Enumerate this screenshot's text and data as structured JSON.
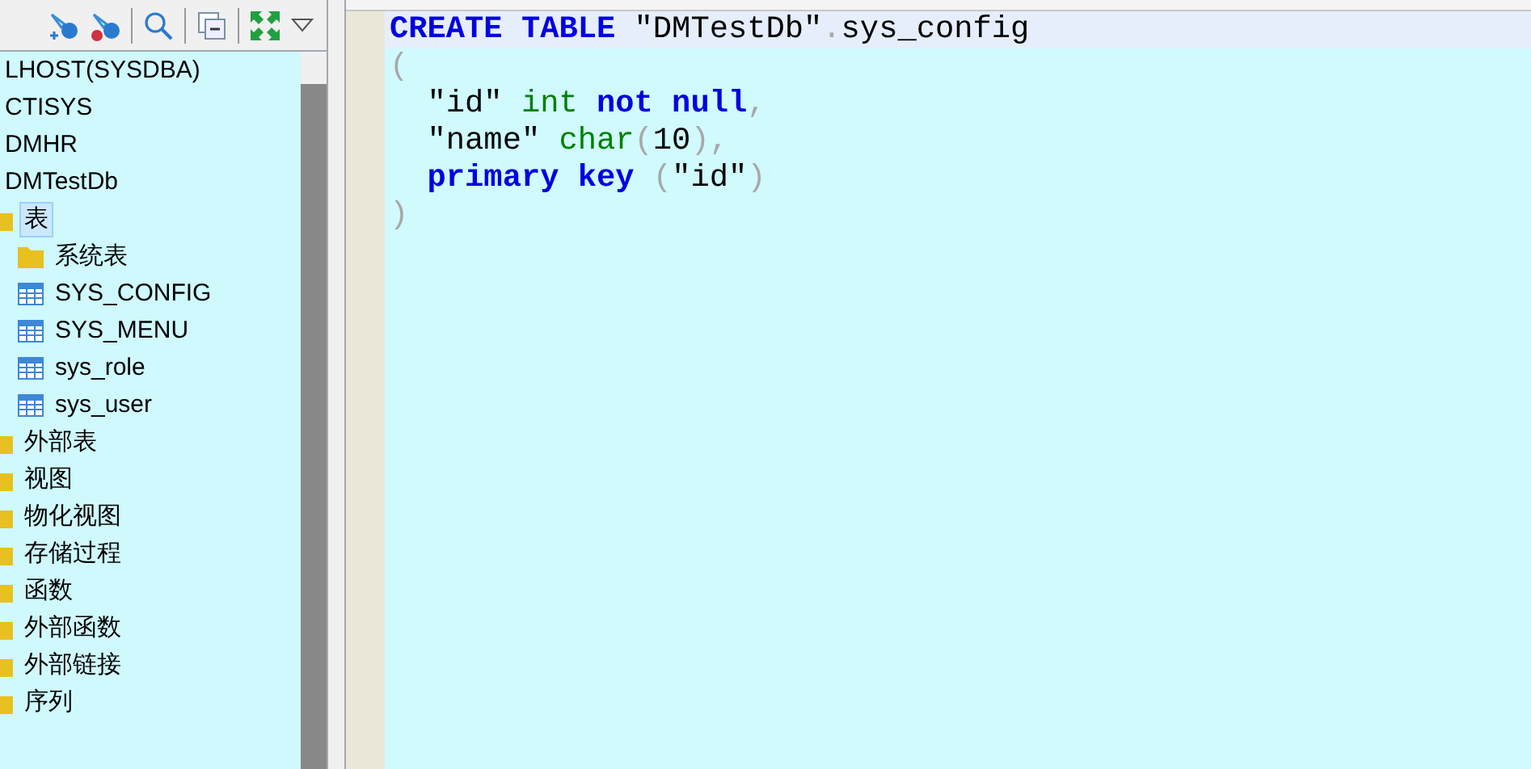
{
  "navigator": {
    "toolbar": [
      {
        "kind": "connect"
      },
      {
        "kind": "disconnect"
      },
      {
        "kind": "sep"
      },
      {
        "kind": "search"
      },
      {
        "kind": "sep"
      },
      {
        "kind": "collapse"
      },
      {
        "kind": "sep"
      },
      {
        "kind": "expand"
      },
      {
        "kind": "menu"
      }
    ],
    "tree": [
      {
        "label": "LHOST(SYSDBA)",
        "selected": false
      },
      {
        "label": "CTISYS",
        "selected": false
      },
      {
        "label": "DMHR",
        "selected": false
      },
      {
        "label": "DMTestDb",
        "selected": false,
        "children": [
          {
            "label": "表",
            "kind": "folder",
            "selected": true,
            "children": [
              {
                "label": "系统表",
                "kind": "folder",
                "selected": false
              },
              {
                "label": "SYS_CONFIG",
                "kind": "table",
                "selected": false
              },
              {
                "label": "SYS_MENU",
                "kind": "table",
                "selected": false
              },
              {
                "label": "sys_role",
                "kind": "table",
                "selected": false
              },
              {
                "label": "sys_user",
                "kind": "table",
                "selected": false
              }
            ]
          },
          {
            "label": "外部表",
            "kind": "folder",
            "selected": false
          },
          {
            "label": "视图",
            "kind": "folder",
            "selected": false
          },
          {
            "label": "物化视图",
            "kind": "folder",
            "selected": false
          },
          {
            "label": "存储过程",
            "kind": "folder",
            "selected": false
          },
          {
            "label": "函数",
            "kind": "folder",
            "selected": false
          },
          {
            "label": "外部函数",
            "kind": "folder",
            "selected": false
          },
          {
            "label": "外部链接",
            "kind": "folder",
            "selected": false
          },
          {
            "label": "序列",
            "kind": "folder",
            "selected": false
          }
        ]
      }
    ]
  },
  "editor": {
    "lines": [
      {
        "current": true,
        "tokens": [
          {
            "kind": "keyword",
            "text": "CREATE TABLE "
          },
          {
            "kind": "plain",
            "text": "\"DMTestDb\""
          },
          {
            "kind": "punct",
            "text": "."
          },
          {
            "kind": "plain",
            "text": "sys_config"
          }
        ]
      },
      {
        "current": false,
        "tokens": [
          {
            "kind": "punct",
            "text": "("
          }
        ]
      },
      {
        "current": false,
        "tokens": [
          {
            "kind": "plain",
            "text": "  \"id\" "
          },
          {
            "kind": "type",
            "text": "int "
          },
          {
            "kind": "keyword",
            "text": "not null"
          },
          {
            "kind": "punct",
            "text": ","
          }
        ]
      },
      {
        "current": false,
        "tokens": [
          {
            "kind": "plain",
            "text": "  \"name\" "
          },
          {
            "kind": "type",
            "text": "char"
          },
          {
            "kind": "punct",
            "text": "("
          },
          {
            "kind": "plain",
            "text": "10"
          },
          {
            "kind": "punct",
            "text": "),"
          }
        ]
      },
      {
        "current": false,
        "tokens": [
          {
            "kind": "keyword",
            "text": "  primary key "
          },
          {
            "kind": "punct",
            "text": "("
          },
          {
            "kind": "plain",
            "text": "\"id\""
          },
          {
            "kind": "punct",
            "text": ")"
          }
        ]
      },
      {
        "current": false,
        "tokens": [
          {
            "kind": "punct",
            "text": ")"
          }
        ]
      }
    ]
  }
}
